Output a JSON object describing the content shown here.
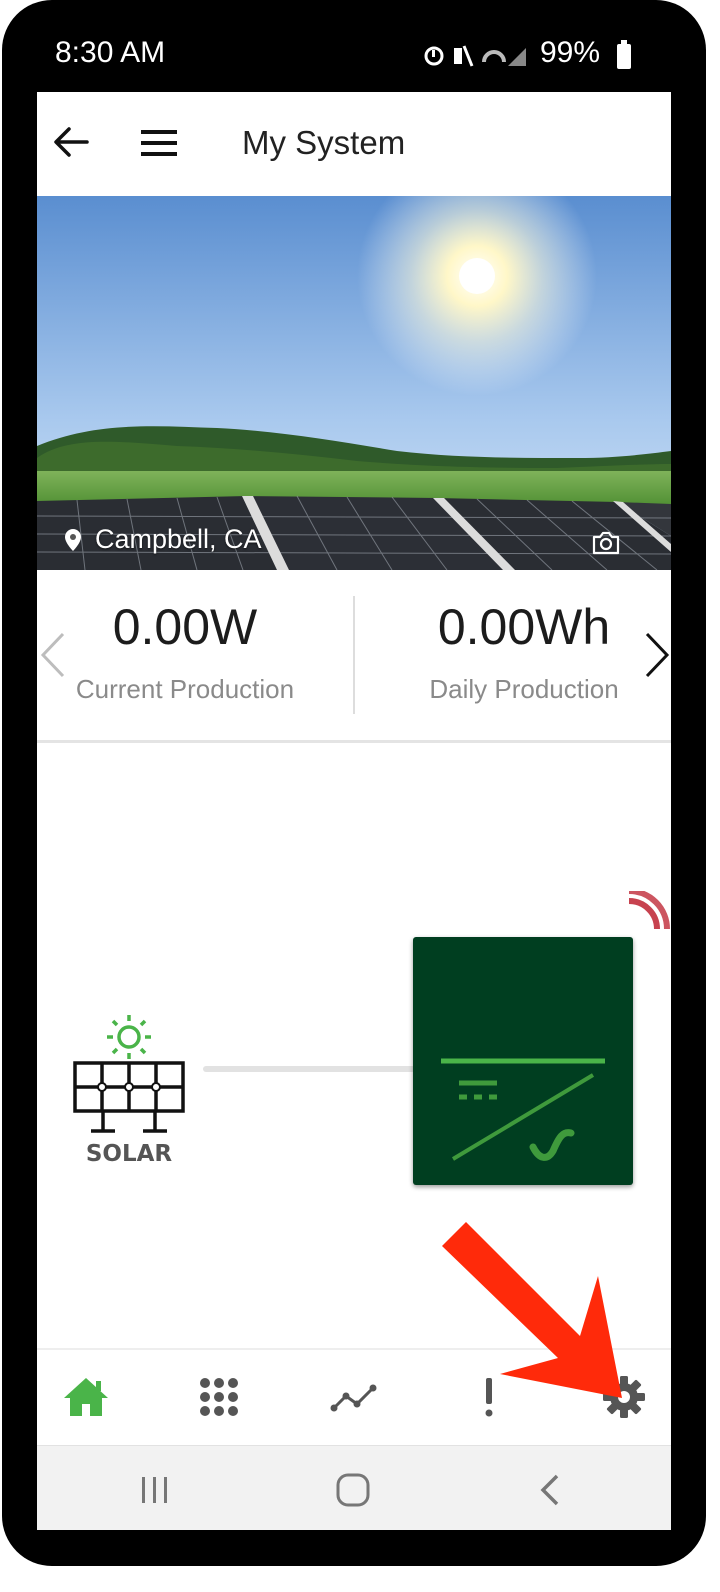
{
  "status_bar": {
    "time": "8:30 AM",
    "battery": "99%"
  },
  "app_bar": {
    "title": "My System"
  },
  "hero": {
    "location": "Campbell, CA"
  },
  "stats": [
    {
      "value": "0.00W",
      "label": "Current Production"
    },
    {
      "value": "0.00Wh",
      "label": "Daily Production"
    }
  ],
  "diagram": {
    "solar_label": "SOLAR"
  },
  "bottom_nav": [
    "home-icon",
    "apps-grid-icon",
    "trend-chart-icon",
    "alert-icon",
    "settings-gear-icon"
  ],
  "colors": {
    "accent_green": "#4ab449",
    "inverter_green": "#003e20",
    "signal_red": "#c7424f",
    "annotation_red": "#ff2a0a"
  }
}
